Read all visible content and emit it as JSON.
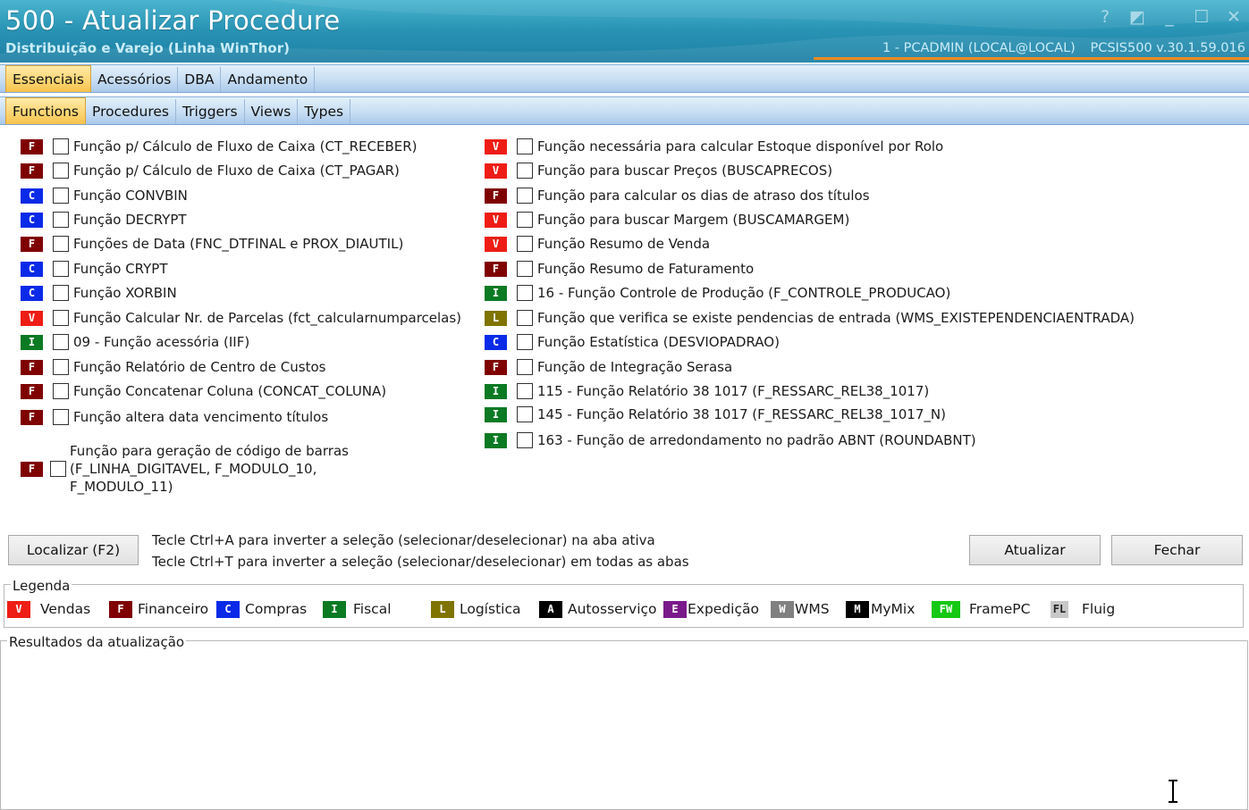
{
  "window": {
    "title": "500 - Atualizar Procedure",
    "subtitle": "Distribuição e Varejo (Linha WinThor)",
    "session_user": "1 - PCADMIN (LOCAL@LOCAL)",
    "session_version": "PCSIS500  v.30.1.59.016",
    "controls": {
      "help": "?",
      "restore": "◩",
      "minimize": "_",
      "maximize": "☐",
      "close": "✕"
    }
  },
  "tabs_main": [
    "Essenciais",
    "Acessórios",
    "DBA",
    "Andamento"
  ],
  "tabs_sub": [
    "Functions",
    "Procedures",
    "Triggers",
    "Views",
    "Types"
  ],
  "colors": {
    "V": "#ee1d15",
    "F": "#7f0000",
    "C": "#0a2ae8",
    "I": "#0b7a23",
    "L": "#7f7400",
    "A": "#000000",
    "E": "#7a1a8a",
    "W": "#808080",
    "M": "#000000",
    "FW": "#14c814",
    "FL": "#c8c8c8"
  },
  "functions_left": [
    {
      "code": "F",
      "label": "Função p/ Cálculo de Fluxo de Caixa (CT_RECEBER)"
    },
    {
      "code": "F",
      "label": "Função p/ Cálculo de Fluxo de Caixa (CT_PAGAR)"
    },
    {
      "code": "C",
      "label": "Função CONVBIN"
    },
    {
      "code": "C",
      "label": "Função DECRYPT"
    },
    {
      "code": "F",
      "label": "Funções de Data (FNC_DTFINAL e PROX_DIAUTIL)"
    },
    {
      "code": "C",
      "label": "Função CRYPT"
    },
    {
      "code": "C",
      "label": "Função XORBIN"
    },
    {
      "code": "V",
      "label": "Função Calcular Nr. de Parcelas (fct_calcularnumparcelas)"
    },
    {
      "code": "I",
      "label": "09 - Função acessória (IIF)"
    },
    {
      "code": "F",
      "label": "Função Relatório de Centro de Custos"
    },
    {
      "code": "F",
      "label": "Função Concatenar Coluna (CONCAT_COLUNA)"
    },
    {
      "code": "F",
      "label": "Função altera data vencimento títulos"
    },
    {
      "code": "F",
      "label": "Função para geração de código de barras (F_LINHA_DIGITAVEL, F_MODULO_10, F_MODULO_11)"
    }
  ],
  "functions_right": [
    {
      "code": "V",
      "label": "Função necessária para calcular Estoque disponível por Rolo"
    },
    {
      "code": "V",
      "label": "Função para buscar Preços (BUSCAPRECOS)"
    },
    {
      "code": "F",
      "label": "Função para calcular os dias de atraso dos títulos"
    },
    {
      "code": "V",
      "label": "Função para buscar Margem (BUSCAMARGEM)"
    },
    {
      "code": "V",
      "label": "Função Resumo de Venda"
    },
    {
      "code": "F",
      "label": "Função Resumo de Faturamento"
    },
    {
      "code": "I",
      "label": "16 - Função Controle de Produção (F_CONTROLE_PRODUCAO)"
    },
    {
      "code": "L",
      "label": "Função que verifica se existe pendencias de entrada (WMS_EXISTEPENDENCIAENTRADA)"
    },
    {
      "code": "C",
      "label": "Função Estatística (DESVIOPADRAO)"
    },
    {
      "code": "F",
      "label": "Função de Integração Serasa"
    },
    {
      "code": "I",
      "label": "115 - Função Relatório 38 1017 (F_RESSARC_REL38_1017)"
    },
    {
      "code": "I",
      "label": "145 - Função Relatório 38 1017 (F_RESSARC_REL38_1017_N)"
    },
    {
      "code": "I",
      "label": "163 - Função de arredondamento no padrão ABNT (ROUNDABNT)"
    }
  ],
  "buttons": {
    "localizar": "Localizar (F2)",
    "atualizar": "Atualizar",
    "fechar": "Fechar"
  },
  "hints": {
    "line1": "Tecle Ctrl+A para inverter a seleção (selecionar/deselecionar) na aba ativa",
    "line2": "Tecle Ctrl+T para inverter a seleção (selecionar/deselecionar) em todas as abas"
  },
  "legend": {
    "title": "Legenda",
    "items": [
      {
        "code": "V",
        "label": "Vendas"
      },
      {
        "code": "F",
        "label": "Financeiro"
      },
      {
        "code": "C",
        "label": "Compras"
      },
      {
        "code": "I",
        "label": "Fiscal"
      },
      {
        "code": "L",
        "label": "Logística"
      },
      {
        "code": "A",
        "label": "Autosserviço"
      },
      {
        "code": "E",
        "label": "Expedição"
      },
      {
        "code": "W",
        "label": "WMS"
      },
      {
        "code": "M",
        "label": "MyMix"
      },
      {
        "code": "FW",
        "label": "FramePC"
      },
      {
        "code": "FL",
        "label": "Fluig"
      }
    ]
  },
  "results": {
    "title": "Resultados da atualização"
  }
}
